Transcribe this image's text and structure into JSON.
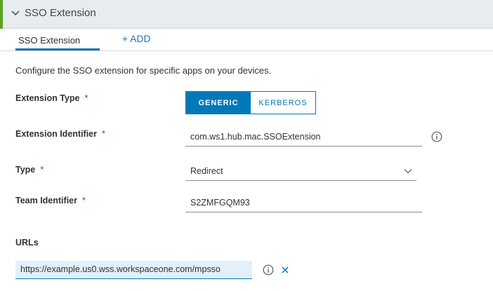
{
  "section": {
    "title": "SSO Extension",
    "accent_color": "#5aa220"
  },
  "tabs": {
    "active": "SSO Extension",
    "add": "+ ADD"
  },
  "description": "Configure the SSO extension for specific apps on your devices.",
  "form": {
    "extension_type": {
      "label": "Extension Type",
      "required": "*",
      "options": [
        "GENERIC",
        "KERBEROS"
      ],
      "selected": "GENERIC"
    },
    "extension_identifier": {
      "label": "Extension Identifier",
      "required": "*",
      "value": "com.ws1.hub.mac.SSOExtension"
    },
    "type": {
      "label": "Type",
      "required": "*",
      "value": "Redirect"
    },
    "team_identifier": {
      "label": "Team Identifier",
      "required": "*",
      "value": "S2ZMFGQM93"
    },
    "urls": {
      "label": "URLs",
      "items": [
        "https://example.us0.wss.workspaceone.com/mpsso"
      ]
    }
  },
  "colors": {
    "primary": "#0079b8",
    "required": "#c92100",
    "header_bg": "#e6ecf0"
  },
  "icons": {
    "collapse": "chevron-down-icon",
    "info": "info-icon",
    "dropdown": "chevron-down-icon",
    "remove": "close-icon"
  }
}
